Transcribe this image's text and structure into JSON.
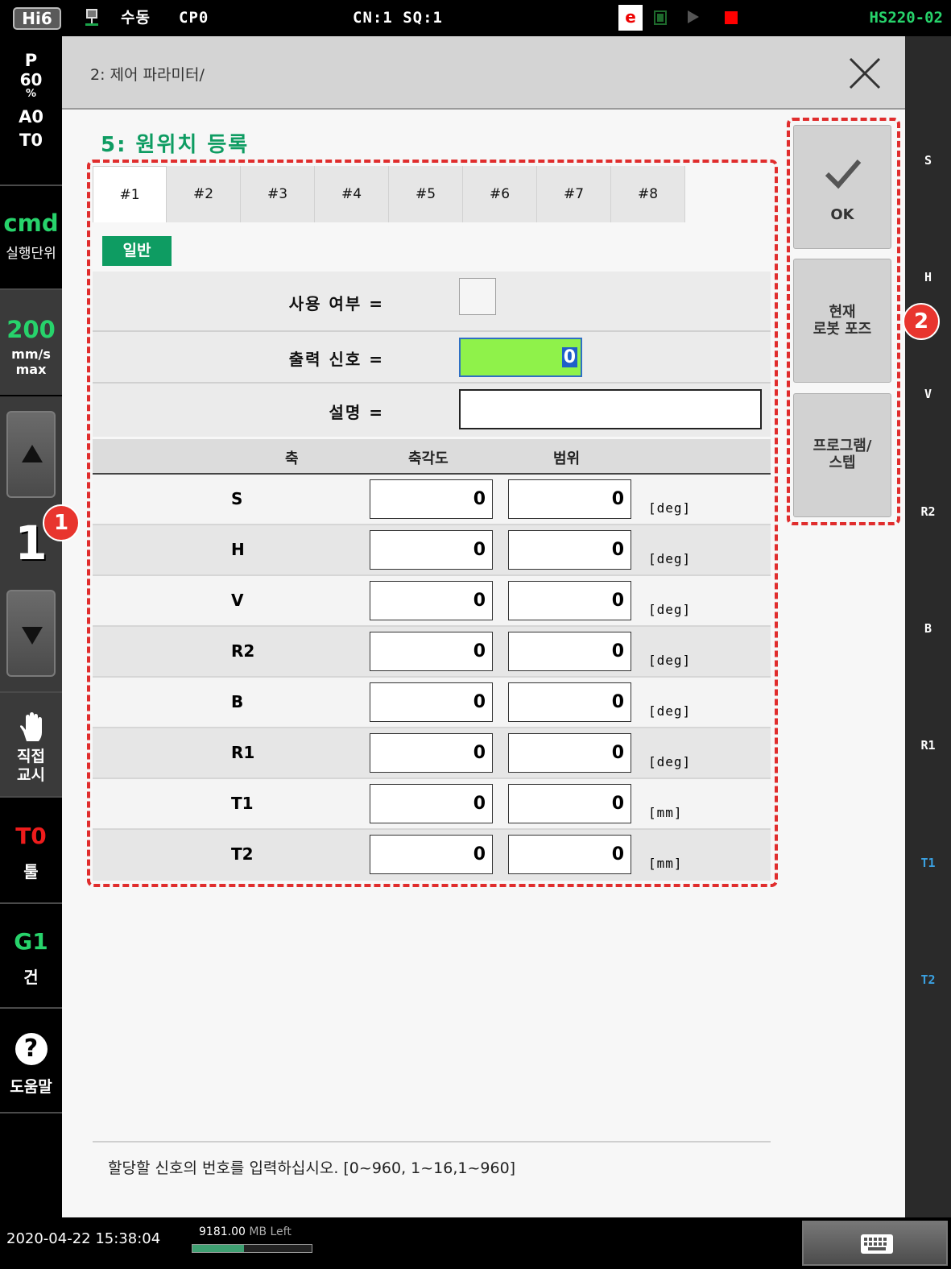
{
  "topbar": {
    "logo": "Hi6",
    "mode": "수동",
    "cp": "CP0",
    "cn_sq": "CN:1 SQ:1",
    "e_label": "e",
    "model": "HS220-02",
    "status_colors": {
      "stop": "#ff0000",
      "model_text": "#27d36b"
    }
  },
  "leftbar": {
    "speed_p": "P",
    "speed_pct": "60",
    "pct_sign": "%",
    "a_val": "A0",
    "t_val": "T0",
    "cmd": "cmd",
    "cmd_sub": "실행단위",
    "speed_val": "200",
    "speed_unit": "mm/s",
    "speed_max": "max",
    "step_num": "1",
    "direct_teach_line1": "직접",
    "direct_teach_line2": "교시",
    "tool_val": "T0",
    "tool_label": "툴",
    "gun_val": "G1",
    "gun_label": "건",
    "help_icon": "?",
    "help_label": "도움말"
  },
  "rightbar": {
    "axes": [
      "S",
      "H",
      "V",
      "R2",
      "B",
      "R1",
      "T1",
      "T2"
    ]
  },
  "main": {
    "breadcrumb": "2: 제어 파라미터/",
    "title": "5: 원위치 등록",
    "tabs": [
      "#1",
      "#2",
      "#3",
      "#4",
      "#5",
      "#6",
      "#7",
      "#8"
    ],
    "active_tab": "#1",
    "section_badge": "일반",
    "general": {
      "use_label": "사용 여부 =",
      "signal_label": "출력 신호 =",
      "signal_value": "0",
      "desc_label": "설명 =",
      "desc_value": ""
    },
    "table": {
      "headers": [
        "축",
        "축각도",
        "범위"
      ],
      "rows": [
        {
          "axis": "S",
          "angle": "0",
          "range": "0",
          "unit": "[deg]"
        },
        {
          "axis": "H",
          "angle": "0",
          "range": "0",
          "unit": "[deg]"
        },
        {
          "axis": "V",
          "angle": "0",
          "range": "0",
          "unit": "[deg]"
        },
        {
          "axis": "R2",
          "angle": "0",
          "range": "0",
          "unit": "[deg]"
        },
        {
          "axis": "B",
          "angle": "0",
          "range": "0",
          "unit": "[deg]"
        },
        {
          "axis": "R1",
          "angle": "0",
          "range": "0",
          "unit": "[deg]"
        },
        {
          "axis": "T1",
          "angle": "0",
          "range": "0",
          "unit": "[mm]"
        },
        {
          "axis": "T2",
          "angle": "0",
          "range": "0",
          "unit": "[mm]"
        }
      ]
    },
    "buttons": {
      "ok": "OK",
      "current_pose": "현재\n로봇 포즈",
      "program_step": "프로그램/\n스텝"
    },
    "annotations": [
      "1",
      "2"
    ],
    "hint": "할당할 신호의 번호를 입력하십시오. [0~960, 1~16,1~960]"
  },
  "bottombar": {
    "datetime": "2020-04-22 15:38:04",
    "mem_value": "9181.00",
    "mem_unit": "MB Left",
    "mem_used_fraction": 0.43
  }
}
